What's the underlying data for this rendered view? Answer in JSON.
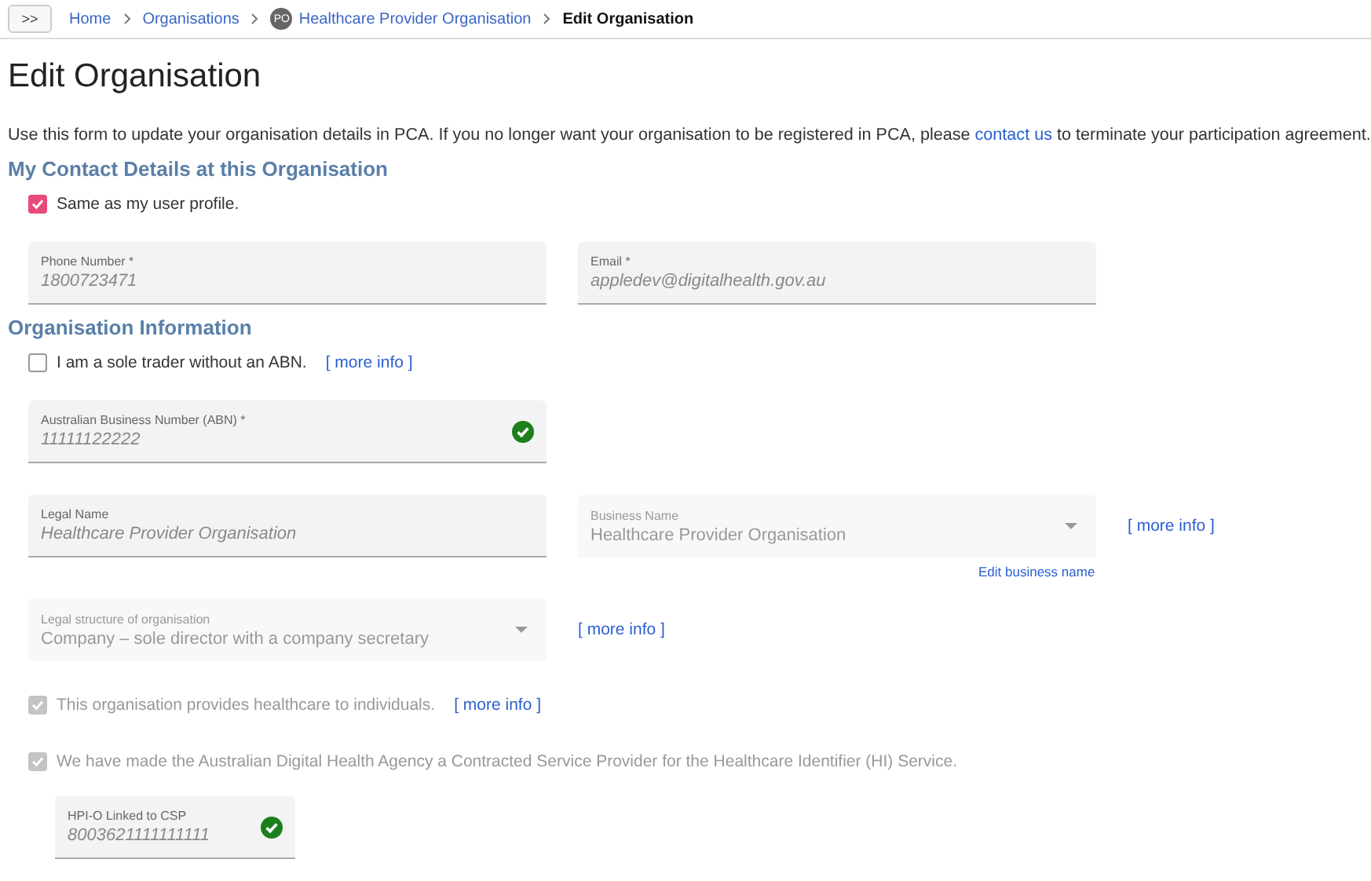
{
  "breadcrumb": {
    "toggle": ">>",
    "items": [
      {
        "label": "Home",
        "current": false
      },
      {
        "label": "Organisations",
        "current": false
      },
      {
        "label": "Healthcare Provider Organisation",
        "badge": "PO",
        "current": false
      },
      {
        "label": "Edit Organisation",
        "current": true
      }
    ]
  },
  "title": "Edit Organisation",
  "intro": {
    "before": "Use this form to update your organisation details in PCA. If you no longer want your organisation to be registered in PCA, please",
    "link": "contact us",
    "after": "to terminate your participation agreement."
  },
  "contact": {
    "heading": "My Contact Details at this Organisation",
    "same_as_profile": {
      "label": "Same as my user profile.",
      "checked": true,
      "disabled": false
    },
    "fields": [
      {
        "label": "Phone Number *",
        "value": "1800723471",
        "kind": "text"
      },
      {
        "label": "Email *",
        "value": "appledev@digitalhealth.gov.au",
        "kind": "text"
      }
    ]
  },
  "organisation": {
    "heading": "Organisation Information",
    "sole_trader": {
      "label": "I am a sole trader without an ABN.",
      "checked": false,
      "disabled": false,
      "more_info": "[ more info ]"
    },
    "abn": {
      "label": "Australian Business Number (ABN) *",
      "value": "11111122222",
      "kind": "text",
      "valid": true
    },
    "legal_name": {
      "label": "Legal Name",
      "value": "Healthcare Provider Organisation",
      "kind": "text"
    },
    "business_name": {
      "label": "Business Name",
      "value": "Healthcare Provider Organisation",
      "kind": "select",
      "more_info": "[ more info ]",
      "edit_link": "Edit business name"
    },
    "legal_structure": {
      "label": "Legal structure of organisation",
      "value": "Company – sole director with a company secretary",
      "kind": "select",
      "more_info": "[ more info ]"
    },
    "provides_healthcare": {
      "label": "This organisation provides healthcare to individuals.",
      "checked": true,
      "disabled": true,
      "more_info": "[ more info ]"
    },
    "csp": {
      "label": "We have made the Australian Digital Health Agency a Contracted Service Provider for the Healthcare Identifier (HI) Service.",
      "checked": true,
      "disabled": true
    },
    "hpio": {
      "label": "HPI-O Linked to CSP",
      "value": "8003621111111111",
      "kind": "text",
      "valid": true
    }
  }
}
